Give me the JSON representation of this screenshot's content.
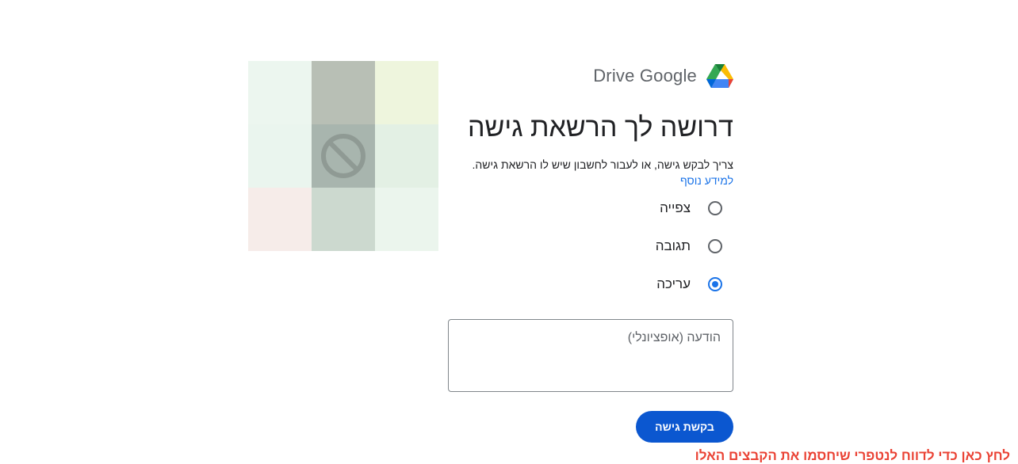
{
  "logo": {
    "text": "Drive Google",
    "icon": "google-drive-logo-icon"
  },
  "title": "דרושה לך הרשאת גישה",
  "description": "צריך לבקש גישה, או לעבור לחשבון שיש לו הרשאת גישה.",
  "learn_more": "למידע נוסף",
  "options": [
    {
      "label": "צפייה",
      "checked": false
    },
    {
      "label": "תגובה",
      "checked": false
    },
    {
      "label": "עריכה",
      "checked": true
    }
  ],
  "message": {
    "placeholder": "הודעה (אופציונלי)",
    "value": ""
  },
  "request_button": "בקשת גישה",
  "report_link": "לחץ כאן כדי לדווח לנטפרי שיחסמו את הקבצים האלו",
  "illustration": {
    "icon": "blocked-icon",
    "colors": [
      "#ecf6ef",
      "#b8bfb5",
      "#eef5dd",
      "#eaf5ee",
      "#a8b5ae",
      "#e3f0e4",
      "#f6ece9",
      "#ccd9cf",
      "#ebf5ed"
    ]
  },
  "colors": {
    "accent": "#1a73e8",
    "button": "#0b57d0",
    "report": "#ea4335"
  }
}
